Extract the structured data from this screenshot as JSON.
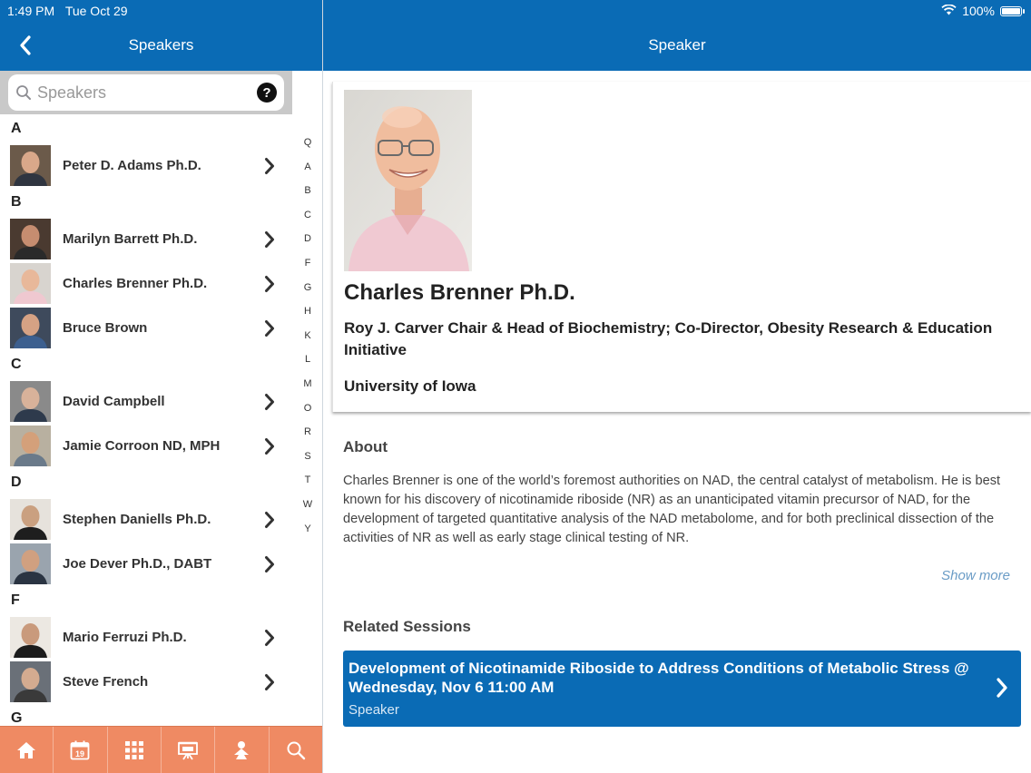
{
  "status_bar": {
    "time": "1:49 PM",
    "date": "Tue Oct 29",
    "battery": "100%"
  },
  "nav": {
    "left_title": "Speakers",
    "right_title": "Speaker"
  },
  "search": {
    "placeholder": "Speakers",
    "help": "?"
  },
  "index_letters": [
    "Q",
    "A",
    "B",
    "C",
    "D",
    "F",
    "G",
    "H",
    "K",
    "L",
    "M",
    "O",
    "R",
    "S",
    "T",
    "W",
    "Y"
  ],
  "sections": [
    {
      "letter": "A",
      "speakers": [
        {
          "name": "Peter D. Adams Ph.D."
        }
      ]
    },
    {
      "letter": "B",
      "speakers": [
        {
          "name": "Marilyn Barrett Ph.D."
        },
        {
          "name": "Charles Brenner Ph.D."
        },
        {
          "name": "Bruce Brown"
        }
      ]
    },
    {
      "letter": "C",
      "speakers": [
        {
          "name": "David Campbell"
        },
        {
          "name": "Jamie Corroon ND, MPH"
        }
      ]
    },
    {
      "letter": "D",
      "speakers": [
        {
          "name": "Stephen Daniells Ph.D."
        },
        {
          "name": "Joe Dever Ph.D., DABT"
        }
      ]
    },
    {
      "letter": "F",
      "speakers": [
        {
          "name": "Mario Ferruzi Ph.D."
        },
        {
          "name": "Steve French"
        }
      ]
    },
    {
      "letter": "G",
      "speakers": []
    }
  ],
  "tabs": [
    "home-icon",
    "calendar-icon",
    "grid-icon",
    "presentation-icon",
    "person-icon",
    "search-icon"
  ],
  "calendar_day": "19",
  "speaker": {
    "name": "Charles Brenner Ph.D.",
    "title": "Roy J. Carver Chair & Head of Biochemistry; Co-Director, Obesity Research & Education Initiative",
    "organization": "University of Iowa",
    "about_header": "About",
    "about": "Charles Brenner is one of the world’s foremost authorities on NAD, the central catalyst of metabolism. He is best known for his discovery of nicotinamide riboside (NR) as an unanticipated vitamin precursor of NAD, for the development of targeted quantitative analysis of the NAD metabolome, and for both preclinical dissection of the activities of NR as well as early stage clinical testing of NR.",
    "show_more": "Show more",
    "related_header": "Related Sessions",
    "sessions": [
      {
        "title": "Development of Nicotinamide Riboside to Address Conditions of Metabolic Stress @ Wednesday, Nov 6 11:00 AM",
        "role": "Speaker"
      }
    ]
  },
  "colors": {
    "primary": "#0a6bb5",
    "tabbar": "#ef8a63"
  }
}
